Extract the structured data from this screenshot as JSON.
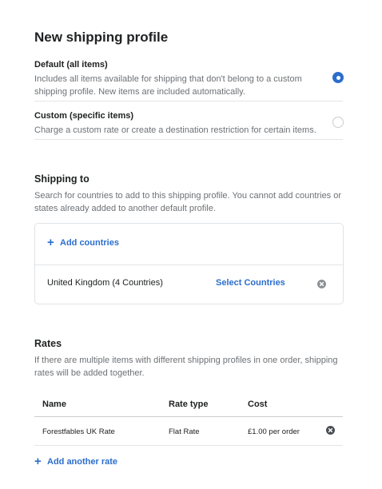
{
  "page": {
    "title": "New shipping profile"
  },
  "profile_options": [
    {
      "title": "Default (all items)",
      "description": "Includes all items available for shipping that don't belong to a custom shipping profile. New items are included automatically.",
      "selected": true
    },
    {
      "title": "Custom (specific items)",
      "description": "Charge a custom rate or create a destination restriction for certain items.",
      "selected": false
    }
  ],
  "shipping_to": {
    "title": "Shipping to",
    "description": "Search for countries to add to this shipping profile. You cannot add countries or states already added to another default profile.",
    "add_countries_label": "Add countries",
    "zones": [
      {
        "name": "United Kingdom (4 Countries)",
        "action_label": "Select Countries"
      }
    ]
  },
  "rates": {
    "title": "Rates",
    "description": "If there are multiple items with different shipping profiles in one order, shipping rates will be added together.",
    "columns": [
      "Name",
      "Rate type",
      "Cost"
    ],
    "rows": [
      {
        "name": "Forestfables UK Rate",
        "rate_type": "Flat Rate",
        "cost": "£1.00 per order"
      }
    ],
    "add_rate_label": "Add another rate"
  },
  "colors": {
    "accent": "#2c6ecb",
    "muted_text": "#6d7175",
    "border": "#dfe3e8",
    "icon_grey": "#8c9196"
  },
  "icons": [
    "radio-selected-icon",
    "radio-unselected-icon",
    "plus-icon",
    "remove-x-icon"
  ]
}
